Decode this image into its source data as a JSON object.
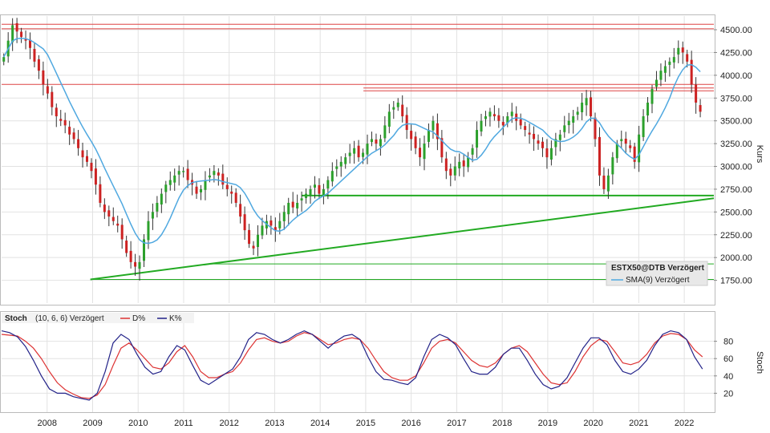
{
  "chart_data": [
    {
      "type": "candlestick",
      "legend": {
        "symbol": "ESTX50@DTB Verzögert",
        "sma_label": "SMA(9) Verzögert"
      },
      "ylabel": "Kurs",
      "ylim": [
        1500,
        4650
      ],
      "yticks": [
        1750,
        2000,
        2250,
        2500,
        2750,
        3000,
        3250,
        3500,
        3750,
        4000,
        4250,
        4500
      ],
      "ytick_labels": [
        "1750.00",
        "2000.00",
        "2250.00",
        "2500.00",
        "2750.00",
        "3000.00",
        "3250.00",
        "3500.00",
        "3750.00",
        "4000.00",
        "4250.00",
        "4500.00"
      ],
      "xlim": [
        2007.0,
        2022.65
      ],
      "x_labels": [
        "2008",
        "2009",
        "2010",
        "2011",
        "2012",
        "2013",
        "2014",
        "2015",
        "2016",
        "2017",
        "2018",
        "2019",
        "2020",
        "2021",
        "2022"
      ],
      "x_label_pos": [
        2008,
        2009,
        2010,
        2011,
        2012,
        2013,
        2014,
        2015,
        2016,
        2017,
        2018,
        2019,
        2020,
        2021,
        2022
      ],
      "colors": {
        "up": "#2ca02c",
        "down": "#cc2222",
        "sma": "#4fa8e0",
        "support": "#22aa22",
        "resistance": "#dd4444"
      },
      "closes": [
        4200,
        4380,
        4550,
        4480,
        4420,
        4380,
        4300,
        4150,
        4050,
        3900,
        3800,
        3650,
        3550,
        3500,
        3450,
        3350,
        3300,
        3200,
        3100,
        3050,
        2950,
        2800,
        2600,
        2500,
        2450,
        2400,
        2350,
        2200,
        2050,
        1950,
        1900,
        1950,
        2200,
        2400,
        2500,
        2600,
        2700,
        2800,
        2850,
        2900,
        2950,
        2950,
        2850,
        2800,
        2700,
        2750,
        2850,
        2900,
        2950,
        2900,
        2800,
        2750,
        2700,
        2600,
        2450,
        2300,
        2150,
        2100,
        2250,
        2350,
        2400,
        2350,
        2300,
        2400,
        2500,
        2600,
        2550,
        2600,
        2650,
        2700,
        2750,
        2800,
        2700,
        2750,
        2850,
        2950,
        3000,
        3050,
        3100,
        3150,
        3200,
        3100,
        3150,
        3250,
        3300,
        3250,
        3300,
        3450,
        3600,
        3650,
        3700,
        3550,
        3400,
        3300,
        3200,
        3100,
        3250,
        3400,
        3500,
        3300,
        3100,
        2950,
        2900,
        3000,
        3050,
        3000,
        3100,
        3200,
        3400,
        3500,
        3550,
        3600,
        3550,
        3500,
        3450,
        3550,
        3600,
        3500,
        3450,
        3400,
        3350,
        3300,
        3250,
        3200,
        3100,
        3200,
        3300,
        3350,
        3450,
        3500,
        3550,
        3600,
        3700,
        3750,
        3550,
        3300,
        2900,
        2750,
        2900,
        3100,
        3250,
        3300,
        3250,
        3200,
        3050,
        3350,
        3550,
        3700,
        3850,
        3950,
        4050,
        4100,
        4150,
        4200,
        4300,
        4250,
        4150,
        3900,
        3700,
        3600
      ],
      "sma_label_value": "SMA(9)",
      "support_levels": [
        2680,
        1930,
        1760
      ],
      "resistance_levels": [
        4560,
        4510,
        3900,
        3860,
        3830
      ]
    },
    {
      "type": "line",
      "legend": {
        "indicator": "Stoch",
        "params": "(10, 6, 6) Verzögert",
        "d_label": "D%",
        "k_label": "K%"
      },
      "ylabel": "Stoch",
      "ylim": [
        0,
        100
      ],
      "yticks": [
        20,
        40,
        60,
        80
      ],
      "series": [
        {
          "name": "D%",
          "color": "#dd3333",
          "values": [
            88,
            87,
            86,
            80,
            72,
            60,
            45,
            32,
            24,
            19,
            15,
            14,
            18,
            30,
            52,
            72,
            78,
            70,
            60,
            50,
            48,
            55,
            68,
            75,
            62,
            45,
            38,
            38,
            42,
            45,
            55,
            70,
            82,
            84,
            80,
            78,
            80,
            86,
            90,
            88,
            82,
            76,
            78,
            82,
            84,
            82,
            72,
            58,
            45,
            38,
            35,
            35,
            40,
            55,
            72,
            80,
            82,
            78,
            68,
            58,
            52,
            50,
            55,
            65,
            72,
            75,
            68,
            55,
            42,
            32,
            30,
            32,
            45,
            62,
            75,
            82,
            80,
            68,
            55,
            53,
            56,
            65,
            78,
            86,
            89,
            88,
            82,
            70,
            62
          ]
        },
        {
          "name": "K%",
          "color": "#222288",
          "values": [
            92,
            90,
            85,
            74,
            58,
            40,
            25,
            20,
            20,
            16,
            14,
            12,
            20,
            45,
            78,
            88,
            82,
            65,
            50,
            42,
            45,
            62,
            75,
            70,
            52,
            35,
            30,
            36,
            42,
            48,
            62,
            82,
            90,
            88,
            82,
            78,
            82,
            88,
            92,
            88,
            80,
            72,
            80,
            86,
            88,
            82,
            62,
            45,
            36,
            35,
            32,
            30,
            38,
            62,
            82,
            88,
            84,
            76,
            60,
            45,
            42,
            42,
            50,
            65,
            72,
            72,
            58,
            42,
            30,
            25,
            28,
            38,
            55,
            72,
            84,
            84,
            76,
            58,
            45,
            42,
            48,
            58,
            75,
            88,
            92,
            90,
            82,
            62,
            48
          ]
        }
      ]
    }
  ]
}
